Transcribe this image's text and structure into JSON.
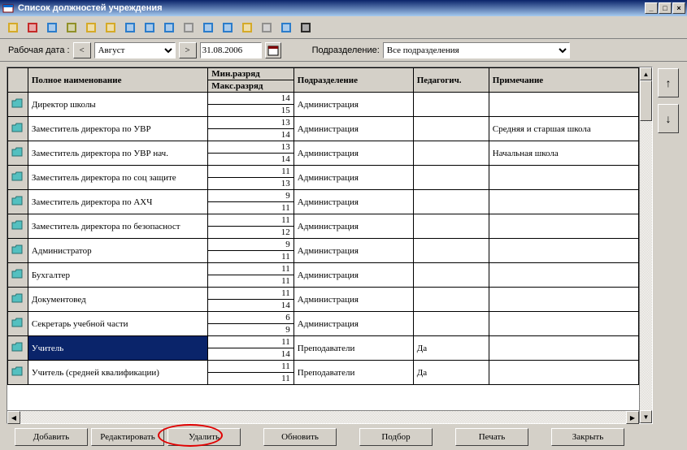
{
  "window_title": "Список должностей учреждения",
  "toolbar": {
    "icons": [
      "new",
      "exclude",
      "search",
      "grid",
      "table",
      "table-del",
      "struct",
      "detail",
      "sort",
      "filter",
      "reset",
      "move",
      "wizard",
      "copy",
      "help",
      "arrow-help"
    ]
  },
  "filter": {
    "work_date_label": "Рабочая дата :",
    "month": "Август",
    "date_value": "31.08.2006",
    "podr_label": "Подразделение:",
    "podr_value": "Все подразделения"
  },
  "headers": {
    "name": "Полное наименование",
    "min": "Мин.разряд",
    "max": "Макс.разряд",
    "podr": "Подразделение",
    "ped": "Педагогич.",
    "prim": "Примечание"
  },
  "rows": [
    {
      "name": "Директор школы",
      "min": "14",
      "max": "15",
      "podr": "Администрация",
      "ped": "",
      "note": ""
    },
    {
      "name": "Заместитель директора по УВР",
      "min": "13",
      "max": "14",
      "podr": "Администрация",
      "ped": "",
      "note": "Средняя и старшая школа"
    },
    {
      "name": "Заместитель директора по УВР нач.",
      "min": "13",
      "max": "14",
      "podr": "Администрация",
      "ped": "",
      "note": "Начальная школа"
    },
    {
      "name": "Заместитель директора по соц защите",
      "min": "11",
      "max": "13",
      "podr": "Администрация",
      "ped": "",
      "note": ""
    },
    {
      "name": "Заместитель директора по АХЧ",
      "min": "9",
      "max": "11",
      "podr": "Администрация",
      "ped": "",
      "note": ""
    },
    {
      "name": "Заместитель директора по безопасност",
      "min": "11",
      "max": "12",
      "podr": "Администрация",
      "ped": "",
      "note": ""
    },
    {
      "name": "Администратор",
      "min": "9",
      "max": "11",
      "podr": "Администрация",
      "ped": "",
      "note": ""
    },
    {
      "name": "Бухгалтер",
      "min": "11",
      "max": "11",
      "podr": "Администрация",
      "ped": "",
      "note": ""
    },
    {
      "name": "Документовед",
      "min": "11",
      "max": "14",
      "podr": "Администрация",
      "ped": "",
      "note": ""
    },
    {
      "name": "Секретарь учебной части",
      "min": "6",
      "max": "9",
      "podr": "Администрация",
      "ped": "",
      "note": ""
    },
    {
      "name": "Учитель",
      "min": "11",
      "max": "14",
      "podr": "Преподаватели",
      "ped": "Да",
      "note": "",
      "selected": true
    },
    {
      "name": "Учитель (средней квалификации)",
      "min": "11",
      "max": "11",
      "podr": "Преподаватели",
      "ped": "Да",
      "note": ""
    }
  ],
  "footer": {
    "add": "Добавить",
    "edit": "Редактировать",
    "del": "Удалить",
    "refresh": "Обновить",
    "pick": "Подбор",
    "print": "Печать",
    "close": "Закрыть"
  }
}
